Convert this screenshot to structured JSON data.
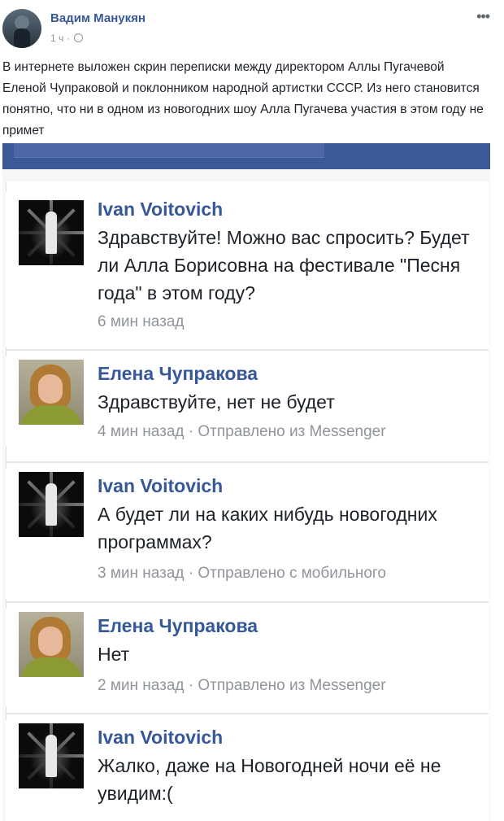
{
  "post": {
    "author": "Вадим Манукян",
    "time": "1 ч",
    "separator": "·",
    "text": "В интернете выложен скрин переписки между директором Аллы Пугачевой Еленой Чупраковой и поклонником народной артистки СССР. Из него становится понятно, что ни в одном из новогодних шоу Алла Пугачева участия в этом году не примет",
    "more_icon": "•••"
  },
  "comments": [
    {
      "author": "Ivan Voitovich",
      "text": "Здравствуйте! Можно вас спросить? Будет ли Алла Борисовна на фестивале \"Песня года\" в этом году?",
      "meta": "6 мин назад"
    },
    {
      "author": "Елена Чупракова",
      "text": "Здравствуйте, нет не будет",
      "meta": "4 мин назад · Отправлено из Messenger"
    },
    {
      "author": "Ivan Voitovich",
      "text": "А будет ли на каких нибудь новогодних программах?",
      "meta": "3 мин назад · Отправлено с мобильного"
    },
    {
      "author": "Елена Чупракова",
      "text": "Нет",
      "meta": "2 мин назад · Отправлено из Messenger"
    },
    {
      "author": "Ivan Voitovich",
      "text": "Жалко, даже на Новогодней ночи её не увидим:(",
      "meta": ""
    }
  ],
  "colors": {
    "link": "#365899",
    "meta": "#90949c",
    "topbar": "#3b5998"
  },
  "icons": {
    "post_visibility": "globe-icon",
    "post_menu": "more-options-icon"
  }
}
